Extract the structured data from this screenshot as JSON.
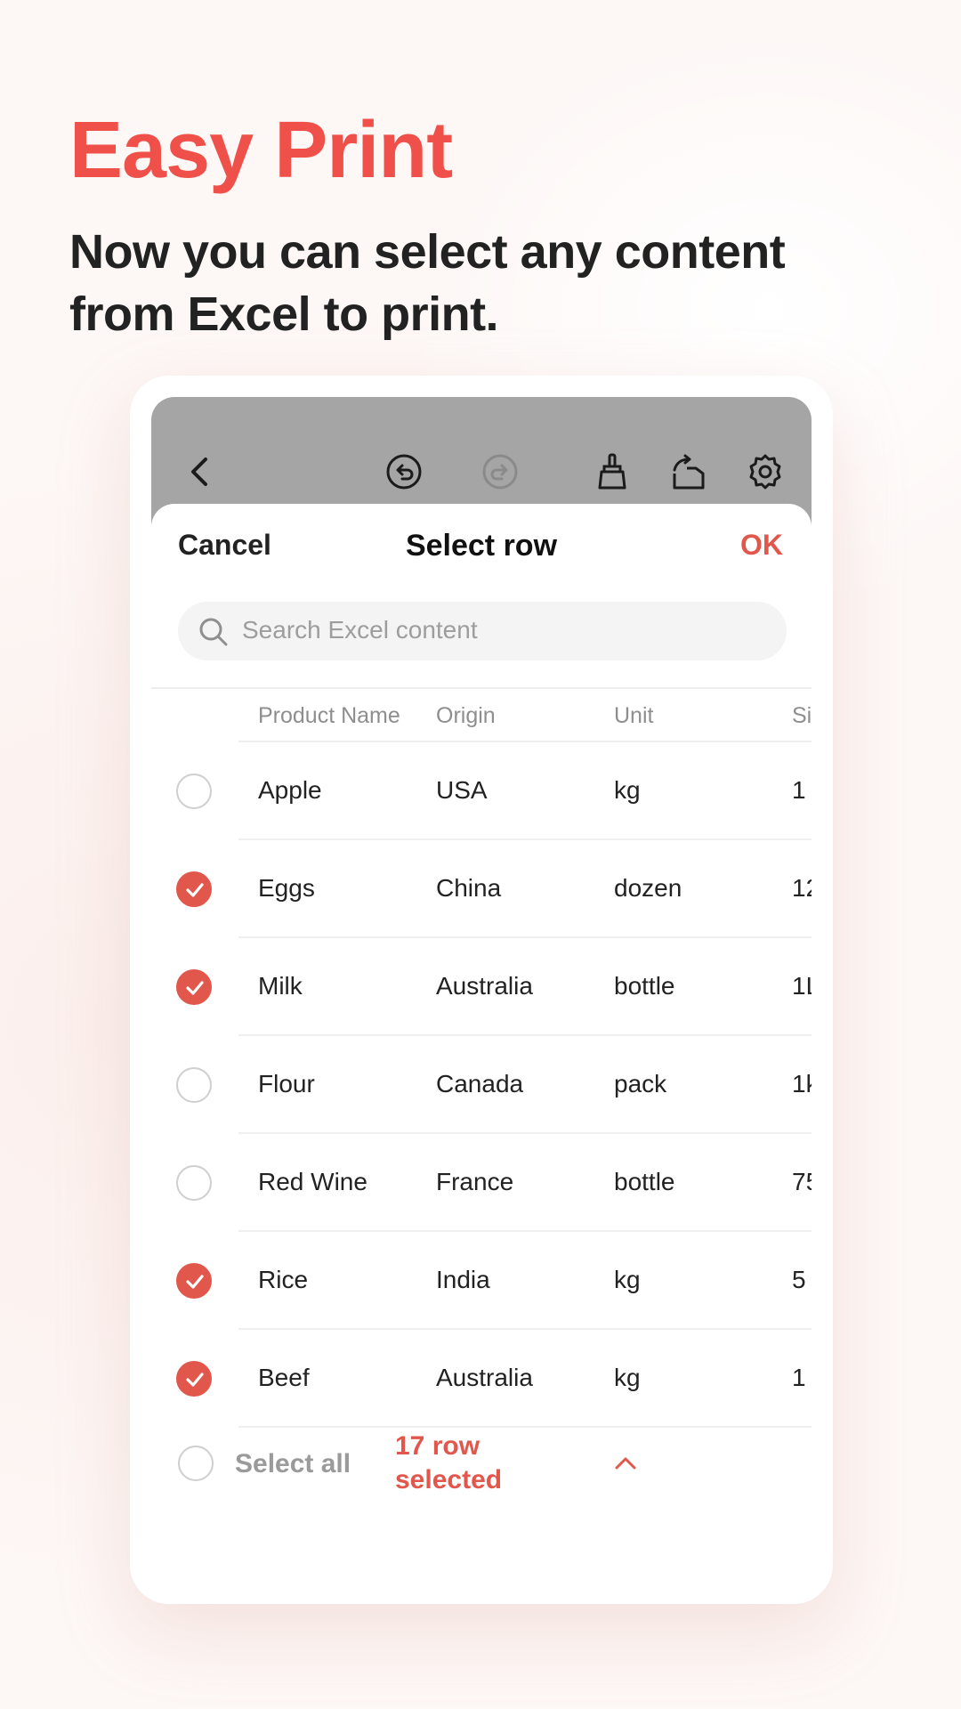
{
  "promo": {
    "title": "Easy Print",
    "subtitle": "Now you can select any content from Excel to print."
  },
  "toolbar": {
    "icons": [
      "back-icon",
      "undo-icon",
      "redo-icon",
      "clear-brush-icon",
      "share-export-icon",
      "settings-gear-icon"
    ],
    "redo_enabled": false
  },
  "sheet": {
    "cancel_label": "Cancel",
    "title": "Select row",
    "ok_label": "OK"
  },
  "search": {
    "placeholder": "Search Excel content"
  },
  "table": {
    "headers": [
      "Product Name",
      "Origin",
      "Unit",
      "Si"
    ],
    "rows": [
      {
        "selected": false,
        "cells": [
          "Apple",
          "USA",
          "kg",
          "1"
        ]
      },
      {
        "selected": true,
        "cells": [
          "Eggs",
          "China",
          "dozen",
          "12"
        ]
      },
      {
        "selected": true,
        "cells": [
          "Milk",
          "Australia",
          "bottle",
          "1L"
        ]
      },
      {
        "selected": false,
        "cells": [
          "Flour",
          "Canada",
          "pack",
          "1k"
        ]
      },
      {
        "selected": false,
        "cells": [
          "Red Wine",
          "France",
          "bottle",
          "75"
        ]
      },
      {
        "selected": true,
        "cells": [
          "Rice",
          "India",
          "kg",
          "5"
        ]
      },
      {
        "selected": true,
        "cells": [
          "Beef",
          "Australia",
          "kg",
          "1"
        ]
      }
    ]
  },
  "footer": {
    "select_all_label": "Select all",
    "selected_count_label": "17 row selected",
    "select_all_checked": false
  },
  "colors": {
    "accent": "#e2574c",
    "title": "#f0504a",
    "toolbar_bg": "#a5a5a5"
  }
}
